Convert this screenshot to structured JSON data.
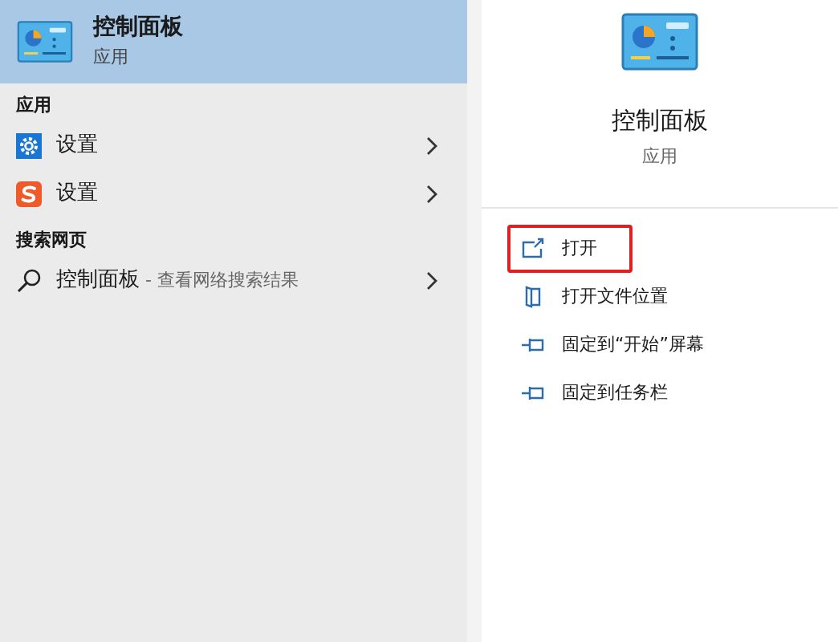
{
  "top_result": {
    "title": "控制面板",
    "subtitle": "应用",
    "selected": true
  },
  "sections": [
    {
      "header": "应用",
      "items": [
        {
          "kind": "settings",
          "label": "设置"
        },
        {
          "kind": "app",
          "label": "设置"
        }
      ]
    },
    {
      "header": "搜索网页",
      "items": [
        {
          "kind": "web",
          "label": "控制面板",
          "hint": " - 查看网络搜索结果"
        }
      ]
    }
  ],
  "details": {
    "title": "控制面板",
    "subtitle": "应用"
  },
  "actions": [
    {
      "kind": "open",
      "label": "打开",
      "highlighted": true
    },
    {
      "kind": "location",
      "label": "打开文件位置",
      "highlighted": false
    },
    {
      "kind": "pin",
      "label": "固定到“开始”屏幕",
      "highlighted": false
    },
    {
      "kind": "pin",
      "label": "固定到任务栏",
      "highlighted": false
    }
  ]
}
